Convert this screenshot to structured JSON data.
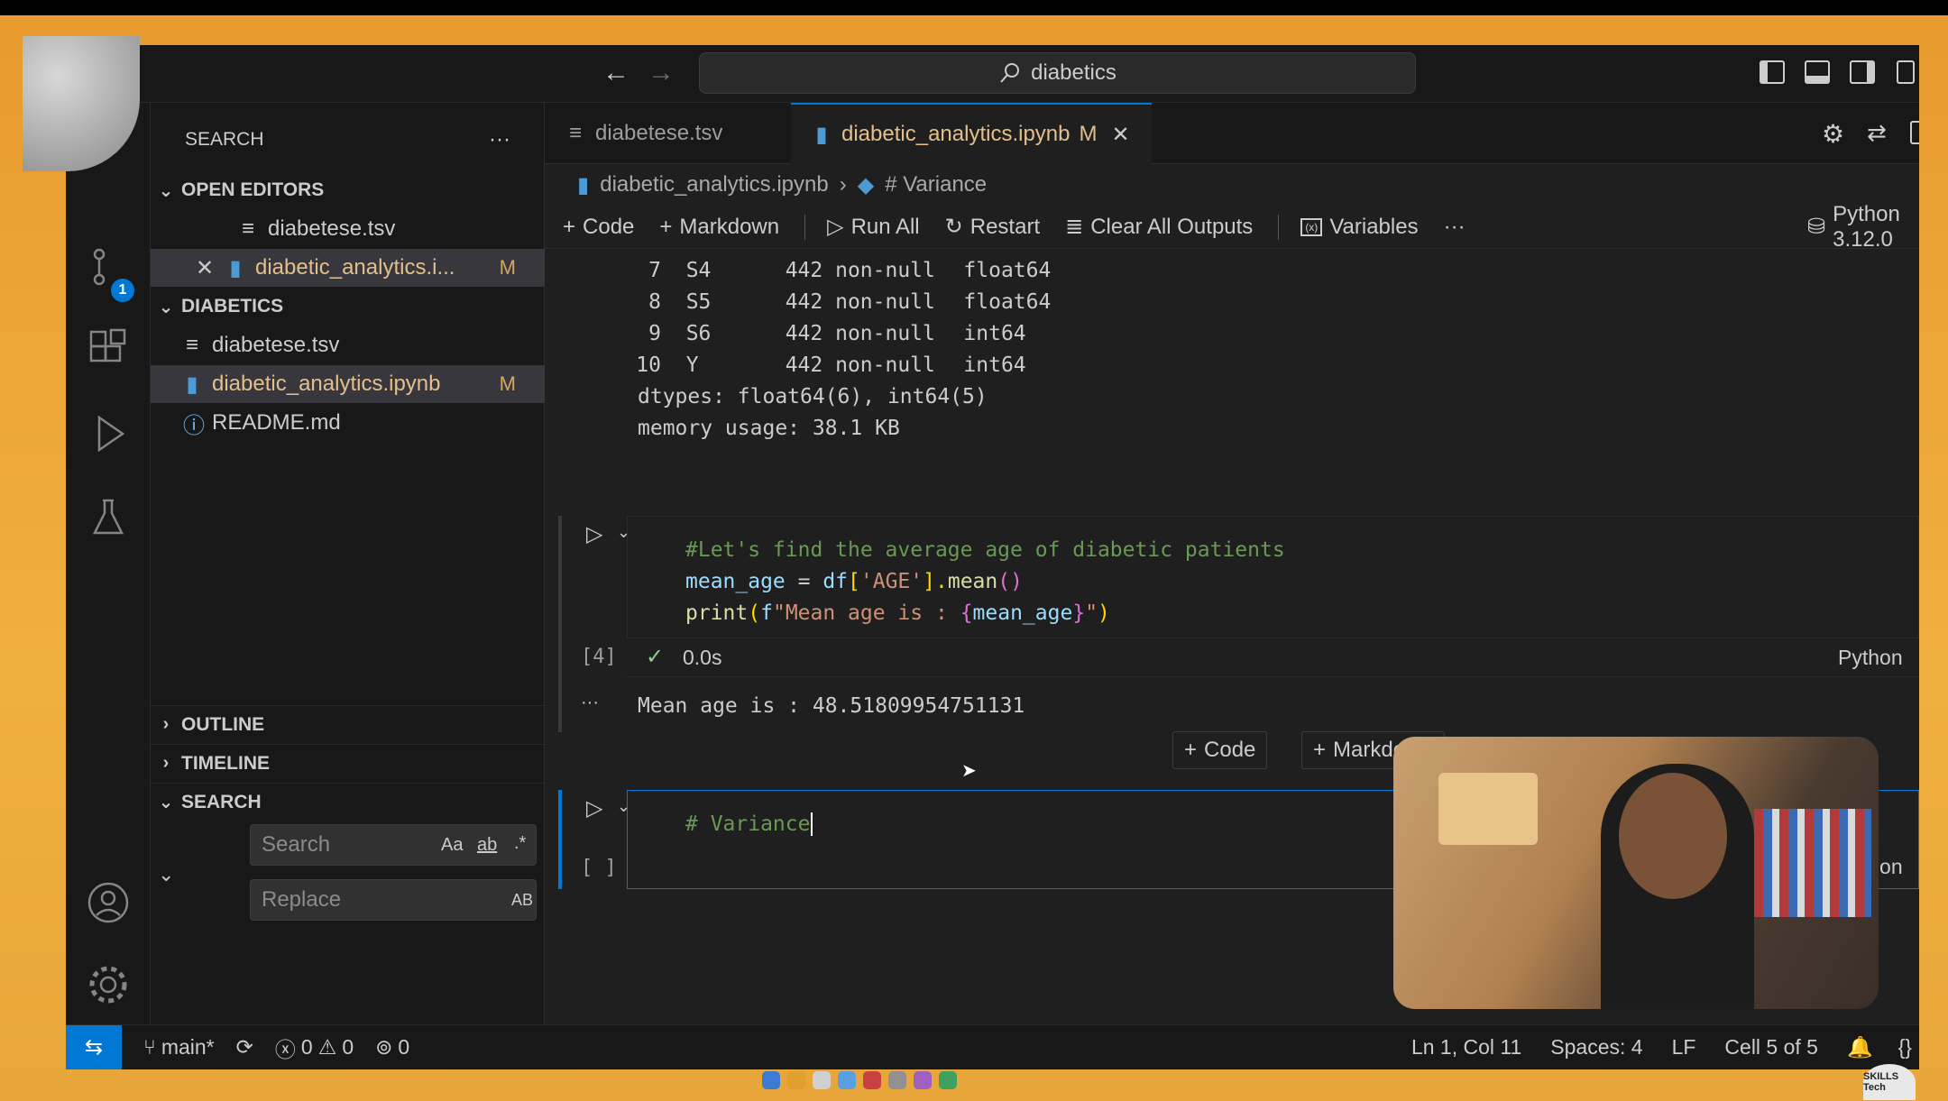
{
  "titlebar": {
    "search_text": "diabetics"
  },
  "activity": {
    "scm_badge": "1"
  },
  "sidebar": {
    "title": "SEARCH",
    "more": "···",
    "open_editors": {
      "header": "OPEN EDITORS",
      "items": [
        {
          "name": "diabetese.tsv",
          "icon": "file-lines-icon",
          "modified": ""
        },
        {
          "name": "diabetic_analytics.i...",
          "icon": "notebook-icon",
          "modified": "M"
        }
      ]
    },
    "folder": {
      "header": "DIABETICS",
      "items": [
        {
          "name": "diabetese.tsv",
          "icon": "file-lines-icon",
          "modified": ""
        },
        {
          "name": "diabetic_analytics.ipynb",
          "icon": "notebook-icon",
          "modified": "M"
        },
        {
          "name": "README.md",
          "icon": "info-icon",
          "modified": ""
        }
      ]
    },
    "outline": "OUTLINE",
    "timeline": "TIMELINE",
    "search_section": "SEARCH",
    "search_placeholder": "Search",
    "replace_placeholder": "Replace",
    "opt_case": "Aa",
    "opt_word": "ab",
    "opt_regex": ".*",
    "opt_preserve": "AB",
    "more_bottom": "···"
  },
  "tabs": [
    {
      "label": "diabetese.tsv",
      "modified": ""
    },
    {
      "label": "diabetic_analytics.ipynb",
      "modified": "M"
    }
  ],
  "breadcrumb": {
    "file": "diabetic_analytics.ipynb",
    "section": "# Variance"
  },
  "toolbar": {
    "code": "Code",
    "markdown": "Markdown",
    "run_all": "Run All",
    "restart": "Restart",
    "clear": "Clear All Outputs",
    "variables": "Variables",
    "more": "···",
    "kernel": "Python 3.12.0"
  },
  "output_top": [
    {
      "idx": "7",
      "col": "S4",
      "count": "442 non-null",
      "dtype": "float64"
    },
    {
      "idx": "8",
      "col": "S5",
      "count": "442 non-null",
      "dtype": "float64"
    },
    {
      "idx": "9",
      "col": "S6",
      "count": "442 non-null",
      "dtype": "int64"
    },
    {
      "idx": "10",
      "col": "Y",
      "count": "442 non-null",
      "dtype": "int64"
    }
  ],
  "output_dtypes": "dtypes: float64(6), int64(5)",
  "output_memory": "memory usage: 38.1 KB",
  "cell4": {
    "comment": "#Let's find the average age of diabetic patients",
    "line2_var": "mean_age",
    "line2_eq": " = ",
    "line2_df": "df",
    "line2_open": "[",
    "line2_str": "'AGE'",
    "line2_close": "].",
    "line2_fn": "mean",
    "line2_paren": "()",
    "line3_fn": "print",
    "line3_open": "(",
    "line3_f": "f",
    "line3_str": "\"Mean age is : ",
    "line3_bo": "{",
    "line3_var": "mean_age",
    "line3_bc": "}",
    "line3_end": "\"",
    "line3_close": ")",
    "exec_count": "[4]",
    "duration": "0.0s",
    "language": "Python",
    "output": "Mean age is : 48.51809954751131",
    "output_menu": "···"
  },
  "insert": {
    "code": "Code",
    "markdown": "Markdown"
  },
  "cell5": {
    "text": "# Variance",
    "exec_count": "[ ]",
    "language": "Python"
  },
  "status": {
    "branch": "main*",
    "errors": "0",
    "warnings": "0",
    "ports": "0",
    "position": "Ln 1, Col 11",
    "spaces": "Spaces: 4",
    "eol": "LF",
    "cell": "Cell 5 of 5"
  },
  "logo": "SKILLS Tech"
}
